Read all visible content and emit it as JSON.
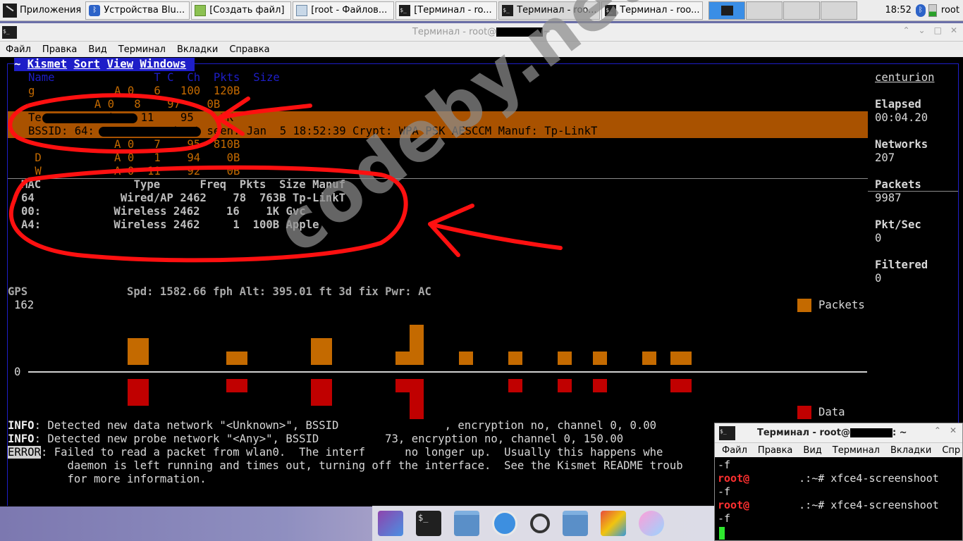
{
  "taskbar": {
    "apps_menu": "Приложения",
    "tasks": [
      {
        "label": "Устройства Blu...",
        "icon": "bluetooth-icon"
      },
      {
        "label": "[Создать файл]",
        "icon": "text-editor-icon"
      },
      {
        "label": "[root - Файлов...",
        "icon": "file-manager-icon"
      },
      {
        "label": "[Терминал - ro...",
        "icon": "terminal-icon"
      },
      {
        "label": "Терминал - roo...",
        "icon": "terminal-icon"
      },
      {
        "label": "Терминал - roo...",
        "icon": "terminal-icon"
      }
    ],
    "clock": "18:52",
    "user": "root"
  },
  "main_window": {
    "title": "Терминал - root@",
    "title_suffix": "~",
    "menu": [
      "Файл",
      "Правка",
      "Вид",
      "Терминал",
      "Вкладки",
      "Справка"
    ]
  },
  "kismet": {
    "menu_prefix": "~ ",
    "menu": [
      "Kismet",
      "Sort",
      "View",
      "Windows"
    ],
    "network_header": "Name               T C  Ch  Pkts  Size",
    "network_rows": [
      "g            A 0   6   100  120B",
      "          A 0   8    97    0B",
      "Te          A    11    95    2K",
      "             A 0   7    95  810B",
      " D           A 0   1    94    0B",
      " W           A 0  11    92    0B"
    ],
    "selected_detail": "BSSID: 64:            Last seen: Jan  5 18:52:39 Crypt: WPA PSK AESCCM Manuf: Tp-LinkT",
    "client_header": "MAC              Type      Freq  Pkts  Size Manuf",
    "client_rows": [
      "64             Wired/AP 2462    78  763B Tp-LinkT",
      "00:           Wireless 2462    16    1K Gvc",
      "A4:           Wireless 2462     1  100B Apple"
    ],
    "gps_line": "GPS               Spd: 1582.66 fph Alt: 395.01 ft 3d fix Pwr: AC",
    "sidebar": {
      "hostname": "centurion",
      "stats": [
        {
          "label": "Elapsed",
          "value": "00:04.20"
        },
        {
          "label": "Networks",
          "value": "207"
        },
        {
          "label": "Packets",
          "value": "9987"
        },
        {
          "label": "Pkt/Sec",
          "value": "0"
        },
        {
          "label": "Filtered",
          "value": "0"
        }
      ]
    },
    "chart": {
      "ymax_label": "162",
      "zero_label": "0",
      "legend_packets": "Packets",
      "legend_data": "Data",
      "color_packets": "#c46a00",
      "color_data": "#c00000"
    },
    "log": [
      {
        "level": "INFO",
        "text": ": Detected new data network \"<Unknown>\", BSSID                , encryption no, channel 0, 0.00"
      },
      {
        "level": "INFO",
        "text": ": Detected new probe network \"<Any>\", BSSID          73, encryption no, channel 0, 150.00"
      },
      {
        "level": "ERROR",
        "text": ": Failed to read a packet from wlan0.  The interf      no longer up.  Usually this happens whe"
      },
      {
        "level": "",
        "text": "         daemon is left running and times out, turning off the interface.  See the Kismet README troub"
      },
      {
        "level": "",
        "text": "         for more information."
      }
    ]
  },
  "watermark": "codeby.net",
  "small_window": {
    "title": "Терминал - root@",
    "title_suffix": ": ~",
    "menu": [
      "Файл",
      "Правка",
      "Вид",
      "Терминал",
      "Вкладки",
      "Спр"
    ],
    "lines": [
      {
        "prompt": "",
        "text": "-f"
      },
      {
        "prompt": "root@",
        "text": ".:~# xfce4-screenshoot"
      },
      {
        "prompt": "",
        "text": "-f"
      },
      {
        "prompt": "root@",
        "text": ".:~# xfce4-screenshoot"
      },
      {
        "prompt": "",
        "text": "-f"
      }
    ]
  }
}
